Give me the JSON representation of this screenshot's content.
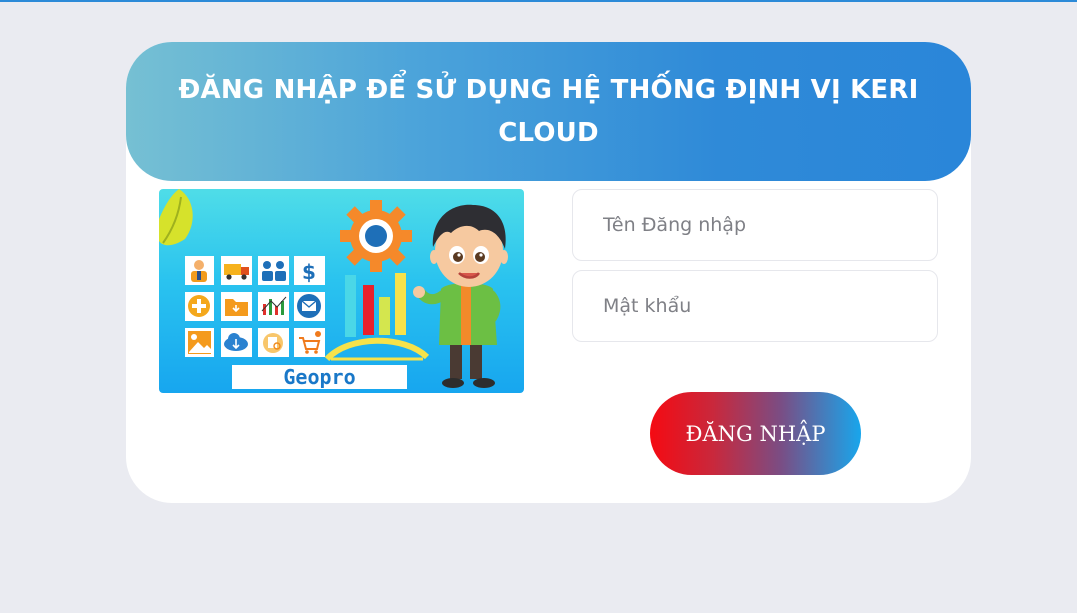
{
  "header": {
    "title": "ĐĂNG NHẬP ĐỂ SỬ DỤNG HỆ THỐNG ĐỊNH VỊ KERI CLOUD"
  },
  "banner": {
    "brand_label": "Geopro"
  },
  "form": {
    "username_placeholder": "Tên Đăng nhập",
    "username_value": "",
    "password_placeholder": "Mật khẩu",
    "password_value": "",
    "submit_label": "ĐĂNG NHẬP"
  },
  "colors": {
    "page_background": "#eaebf1",
    "header_gradient_start": "#76c0d3",
    "header_gradient_end": "#2a86d9",
    "button_gradient_start": "#f50a12",
    "button_gradient_end": "#18a6ec"
  }
}
